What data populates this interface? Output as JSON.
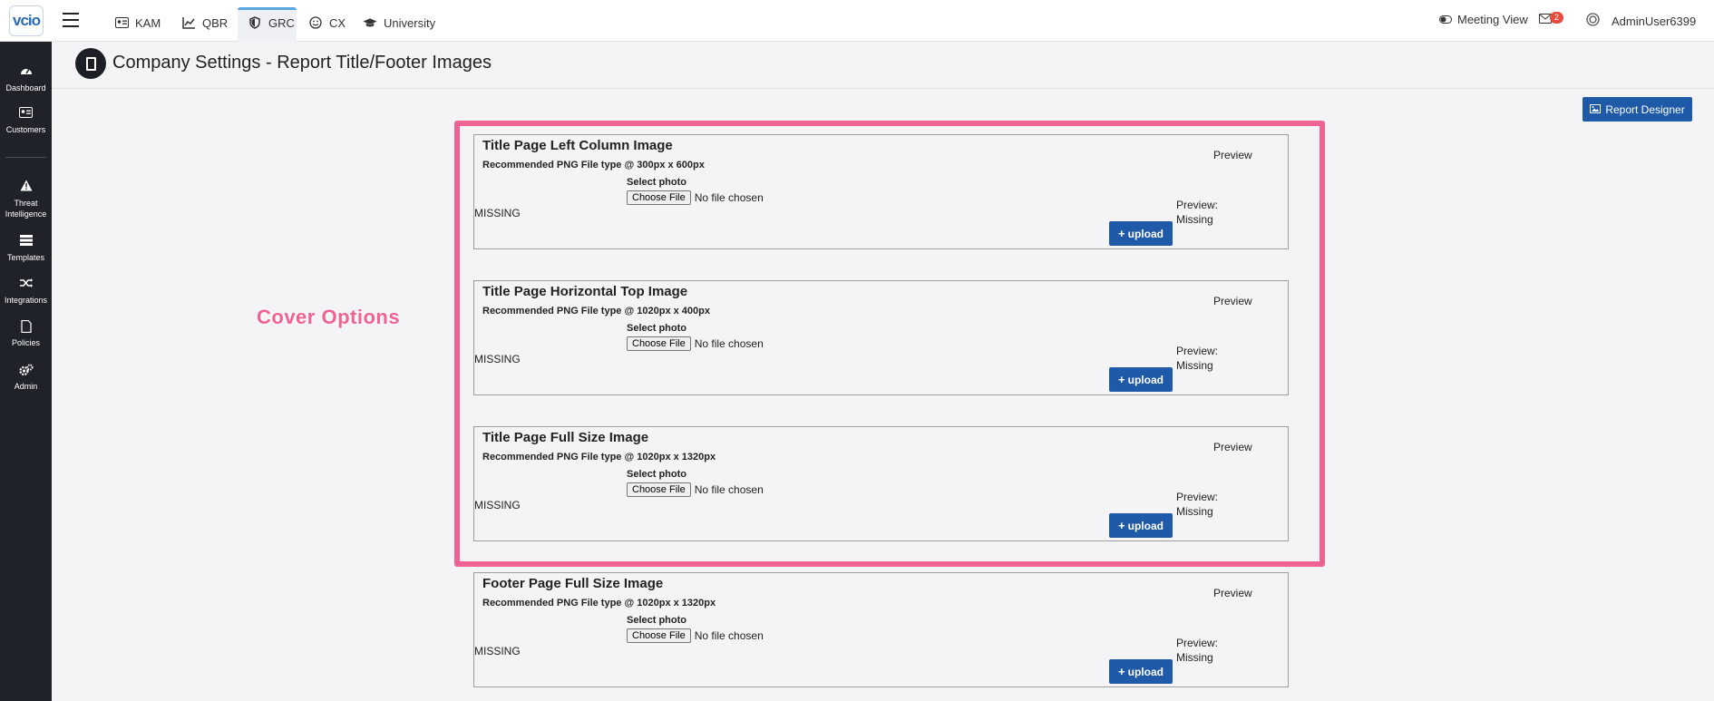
{
  "app": {
    "logo_text": "vcio"
  },
  "nav": {
    "tabs": [
      {
        "label": "KAM",
        "icon": "id-card-icon"
      },
      {
        "label": "QBR",
        "icon": "line-chart-icon"
      },
      {
        "label": "GRC",
        "icon": "shield-icon"
      },
      {
        "label": "CX",
        "icon": "smile-icon"
      },
      {
        "label": "University",
        "icon": "graduation-cap-icon"
      }
    ],
    "active_tab": "GRC",
    "meeting_view": "Meeting View",
    "notification_count": "2",
    "user": "AdminUser6399"
  },
  "sidebar": {
    "items": [
      {
        "label": "Dashboard",
        "icon": "gauge-icon"
      },
      {
        "label": "Customers",
        "icon": "id-card-icon"
      },
      {
        "label": "Threat Intelligence",
        "icon": "warning-icon"
      },
      {
        "label": "Templates",
        "icon": "list-icon"
      },
      {
        "label": "Integrations",
        "icon": "shuffle-icon"
      },
      {
        "label": "Policies",
        "icon": "document-icon"
      },
      {
        "label": "Admin",
        "icon": "gears-icon"
      }
    ]
  },
  "page": {
    "title": "Company Settings - Report Title/Footer Images",
    "report_designer_label": "Report Designer",
    "cover_label": "Cover  Options"
  },
  "panels": [
    {
      "title": "Title Page Left Column Image",
      "recommended": "Recommended PNG File type @ 300px x 600px",
      "select_label": "Select photo",
      "choose_label": "Choose File",
      "no_file": "No file chosen",
      "missing": "MISSING",
      "upload_label": "upload",
      "preview_label": "Preview",
      "preview_status_label": "Preview:",
      "preview_status": "Missing"
    },
    {
      "title": "Title Page Horizontal Top Image",
      "recommended": "Recommended PNG File type @ 1020px x 400px",
      "select_label": "Select photo",
      "choose_label": "Choose File",
      "no_file": "No file chosen",
      "missing": "MISSING",
      "upload_label": "upload",
      "preview_label": "Preview",
      "preview_status_label": "Preview:",
      "preview_status": "Missing"
    },
    {
      "title": "Title Page Full Size Image",
      "recommended": "Recommended PNG File type @ 1020px x 1320px",
      "select_label": "Select photo",
      "choose_label": "Choose File",
      "no_file": "No file chosen",
      "missing": "MISSING",
      "upload_label": "upload",
      "preview_label": "Preview",
      "preview_status_label": "Preview:",
      "preview_status": "Missing"
    },
    {
      "title": "Footer Page Full Size Image",
      "recommended": "Recommended PNG File type @ 1020px x 1320px",
      "select_label": "Select photo",
      "choose_label": "Choose File",
      "no_file": "No file chosen",
      "missing": "MISSING",
      "upload_label": "upload",
      "preview_label": "Preview",
      "preview_status_label": "Preview:",
      "preview_status": "Missing"
    }
  ],
  "colors": {
    "primary": "#1e5aa8",
    "highlight": "#f06292",
    "sidebar_bg": "#1f2229",
    "badge": "#e74c3c",
    "active_tab_accent": "#5aa6e0"
  }
}
